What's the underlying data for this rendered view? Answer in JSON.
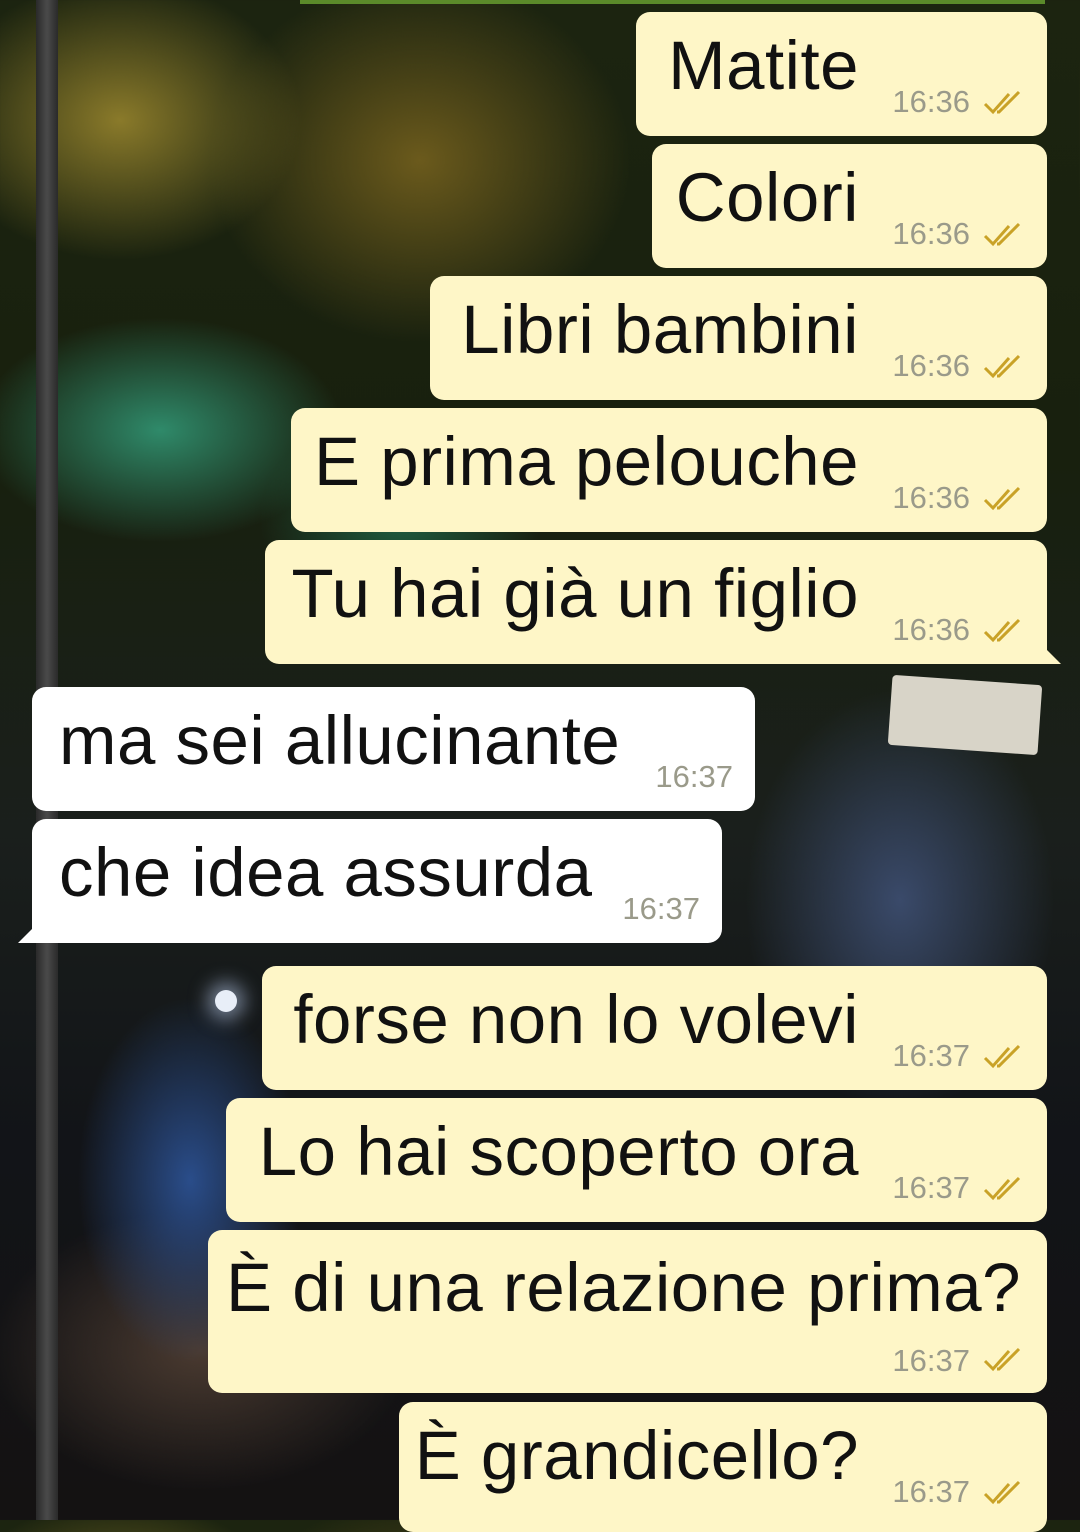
{
  "messages": [
    {
      "text": "Matite",
      "time": "16:36",
      "direction": "out",
      "status": "double-tick-icon"
    },
    {
      "text": "Colori",
      "time": "16:36",
      "direction": "out",
      "status": "double-tick-icon"
    },
    {
      "text": "Libri bambini",
      "time": "16:36",
      "direction": "out",
      "status": "double-tick-icon"
    },
    {
      "text": "E prima pelouche",
      "time": "16:36",
      "direction": "out",
      "status": "double-tick-icon"
    },
    {
      "text": "Tu hai già un figlio",
      "time": "16:36",
      "direction": "out",
      "status": "double-tick-icon"
    },
    {
      "text": "ma sei allucinante",
      "time": "16:37",
      "direction": "in"
    },
    {
      "text": "che idea assurda",
      "time": "16:37",
      "direction": "in"
    },
    {
      "text": "forse non lo volevi",
      "time": "16:37",
      "direction": "out",
      "status": "double-tick-icon"
    },
    {
      "text": "Lo hai scoperto ora",
      "time": "16:37",
      "direction": "out",
      "status": "double-tick-icon"
    },
    {
      "text": "È di una relazione prima?",
      "time": "16:37",
      "direction": "out",
      "status": "double-tick-icon"
    },
    {
      "text": "È grandicello?",
      "time": "16:37",
      "direction": "out",
      "status": "double-tick-icon"
    }
  ],
  "colors": {
    "outgoing_bubble": "#fef6c7",
    "incoming_bubble": "#ffffff",
    "timestamp": "#9a9a8a",
    "read_ticks": "#c9a227"
  }
}
